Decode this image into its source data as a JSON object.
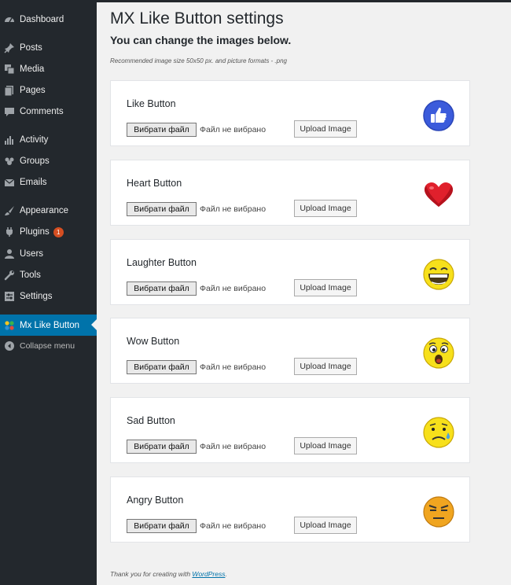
{
  "sidebar": {
    "items": [
      {
        "label": "Dashboard",
        "icon": "dashboard-icon"
      },
      {
        "label": "Posts",
        "icon": "pin-icon"
      },
      {
        "label": "Media",
        "icon": "media-icon"
      },
      {
        "label": "Pages",
        "icon": "pages-icon"
      },
      {
        "label": "Comments",
        "icon": "comment-icon"
      },
      {
        "label": "Activity",
        "icon": "activity-icon"
      },
      {
        "label": "Groups",
        "icon": "groups-icon"
      },
      {
        "label": "Emails",
        "icon": "email-icon"
      },
      {
        "label": "Appearance",
        "icon": "brush-icon"
      },
      {
        "label": "Plugins",
        "icon": "plugin-icon",
        "badge": "1"
      },
      {
        "label": "Users",
        "icon": "users-icon"
      },
      {
        "label": "Tools",
        "icon": "wrench-icon"
      },
      {
        "label": "Settings",
        "icon": "settings-icon"
      },
      {
        "label": "Mx Like Button",
        "icon": "mx-like-icon",
        "active": true
      },
      {
        "label": "Collapse menu",
        "icon": "collapse-icon"
      }
    ]
  },
  "page": {
    "title": "MX Like Button settings",
    "subtitle": "You can change the images below.",
    "note": "Recommended image size 50x50 px. and picture formats - .png"
  },
  "cards": [
    {
      "title": "Like Button",
      "file_button": "Вибрати файл",
      "file_status": "Файл не вибрано",
      "upload": "Upload Image",
      "emoji": "like"
    },
    {
      "title": "Heart Button",
      "file_button": "Вибрати файл",
      "file_status": "Файл не вибрано",
      "upload": "Upload Image",
      "emoji": "heart"
    },
    {
      "title": "Laughter Button",
      "file_button": "Вибрати файл",
      "file_status": "Файл не вибрано",
      "upload": "Upload Image",
      "emoji": "laughter"
    },
    {
      "title": "Wow Button",
      "file_button": "Вибрати файл",
      "file_status": "Файл не вибрано",
      "upload": "Upload Image",
      "emoji": "wow"
    },
    {
      "title": "Sad Button",
      "file_button": "Вибрати файл",
      "file_status": "Файл не вибрано",
      "upload": "Upload Image",
      "emoji": "sad"
    },
    {
      "title": "Angry Button",
      "file_button": "Вибрати файл",
      "file_status": "Файл не вибрано",
      "upload": "Upload Image",
      "emoji": "angry"
    }
  ],
  "footer": {
    "text": "Thank you for creating with ",
    "link": "WordPress",
    "end": "."
  },
  "colors": {
    "sidebar_bg": "#23282d",
    "active": "#0073aa",
    "badge": "#d54e21"
  }
}
